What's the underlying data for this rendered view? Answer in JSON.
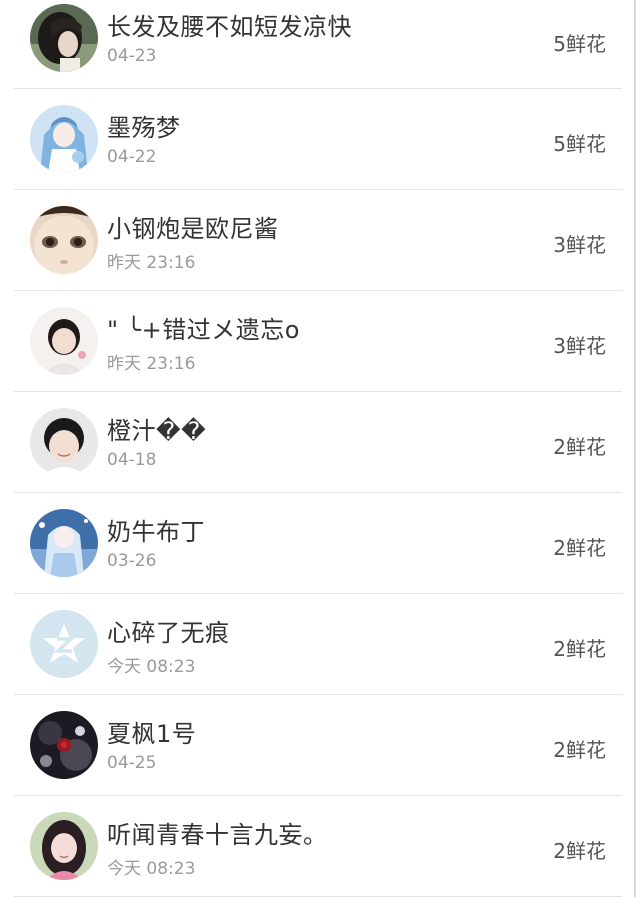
{
  "leaderboard": {
    "rows": [
      {
        "name": "长发及腰不如短发凉快",
        "time": "04-23",
        "flowers": "5鲜花",
        "avatar_icon": "girl-long-hair-avatar"
      },
      {
        "name": "墨殇梦",
        "time": "04-22",
        "flowers": "5鲜花",
        "avatar_icon": "anime-blue-avatar"
      },
      {
        "name": "小钢炮是欧尼酱",
        "time": "昨天 23:16",
        "flowers": "3鲜花",
        "avatar_icon": "doll-face-avatar"
      },
      {
        "name": "\"  ╰+错过メ遗忘o",
        "time": "昨天 23:16",
        "flowers": "3鲜花",
        "avatar_icon": "girl-short-hair-avatar"
      },
      {
        "name": "橙汁��",
        "time": "04-18",
        "flowers": "2鲜花",
        "avatar_icon": "boy-avatar"
      },
      {
        "name": "奶牛布丁",
        "time": "03-26",
        "flowers": "2鲜花",
        "avatar_icon": "anime-white-hair-avatar"
      },
      {
        "name": "心碎了无痕",
        "time": "今天 08:23",
        "flowers": "2鲜花",
        "avatar_icon": "default-qzone-avatar"
      },
      {
        "name": "夏枫1号",
        "time": "04-25",
        "flowers": "2鲜花",
        "avatar_icon": "dark-rose-avatar"
      },
      {
        "name": "听闻青春十言九妄。",
        "time": "今天 08:23",
        "flowers": "2鲜花",
        "avatar_icon": "girl-pink-avatar"
      }
    ]
  }
}
